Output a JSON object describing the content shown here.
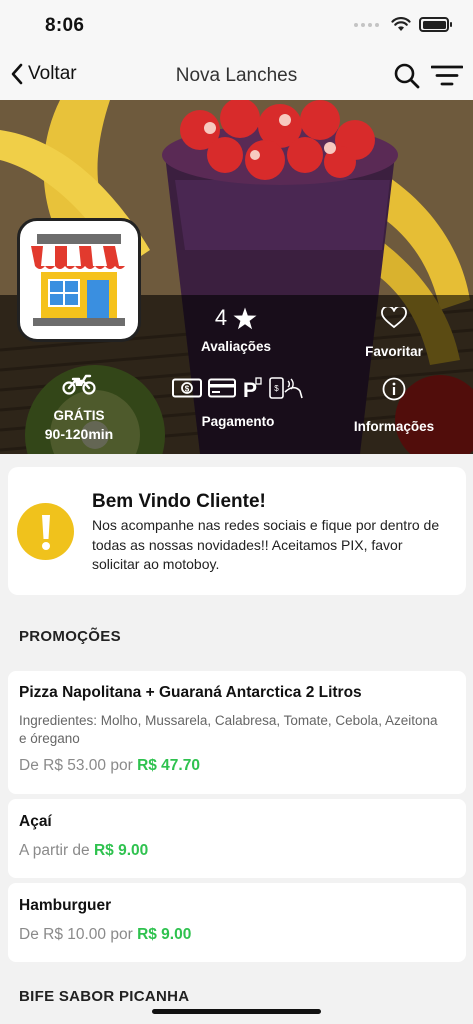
{
  "status_bar": {
    "time": "8:06"
  },
  "nav": {
    "back_label": "Voltar",
    "title": "Nova Lanches"
  },
  "store": {
    "rating": "4",
    "rating_label": "Avaliações",
    "favorite_label": "Favoritar",
    "delivery_fee": "GRÁTIS",
    "delivery_time": "90-120min",
    "payment_label": "Pagamento",
    "info_label": "Informações"
  },
  "welcome": {
    "title": "Bem Vindo Cliente!",
    "text": "Nos acompanhe nas redes sociais e fique por dentro de todas as nossas novidades!! Aceitamos PIX, favor solicitar ao motoboy."
  },
  "sections": [
    {
      "title": "PROMOÇÕES",
      "items": [
        {
          "name": "Pizza Napolitana + Guaraná Antarctica 2 Litros",
          "description": "Ingredientes: Molho, Mussarela, Calabresa, Tomate, Cebola, Azeitona e óregano",
          "price_prefix": "De R$ 53.00 por",
          "price": "R$ 47.70"
        },
        {
          "name": "Açaí",
          "price_prefix": "A partir de",
          "price": "R$ 9.00"
        },
        {
          "name": "Hamburguer",
          "price_prefix": "De R$ 10.00 por",
          "price": "R$ 9.00"
        }
      ]
    },
    {
      "title": "BIFE SABOR PICANHA"
    }
  ],
  "icons": [
    "back-chevron-icon",
    "search-icon",
    "filter-icon",
    "star-icon",
    "heart-icon",
    "motorcycle-icon",
    "cash-icon",
    "card-icon",
    "parking-icon",
    "contactless-icon",
    "info-icon",
    "warning-icon",
    "storefront-icon"
  ],
  "colors": {
    "price_highlight": "#2fc24f",
    "warning": "#f0c21c"
  }
}
